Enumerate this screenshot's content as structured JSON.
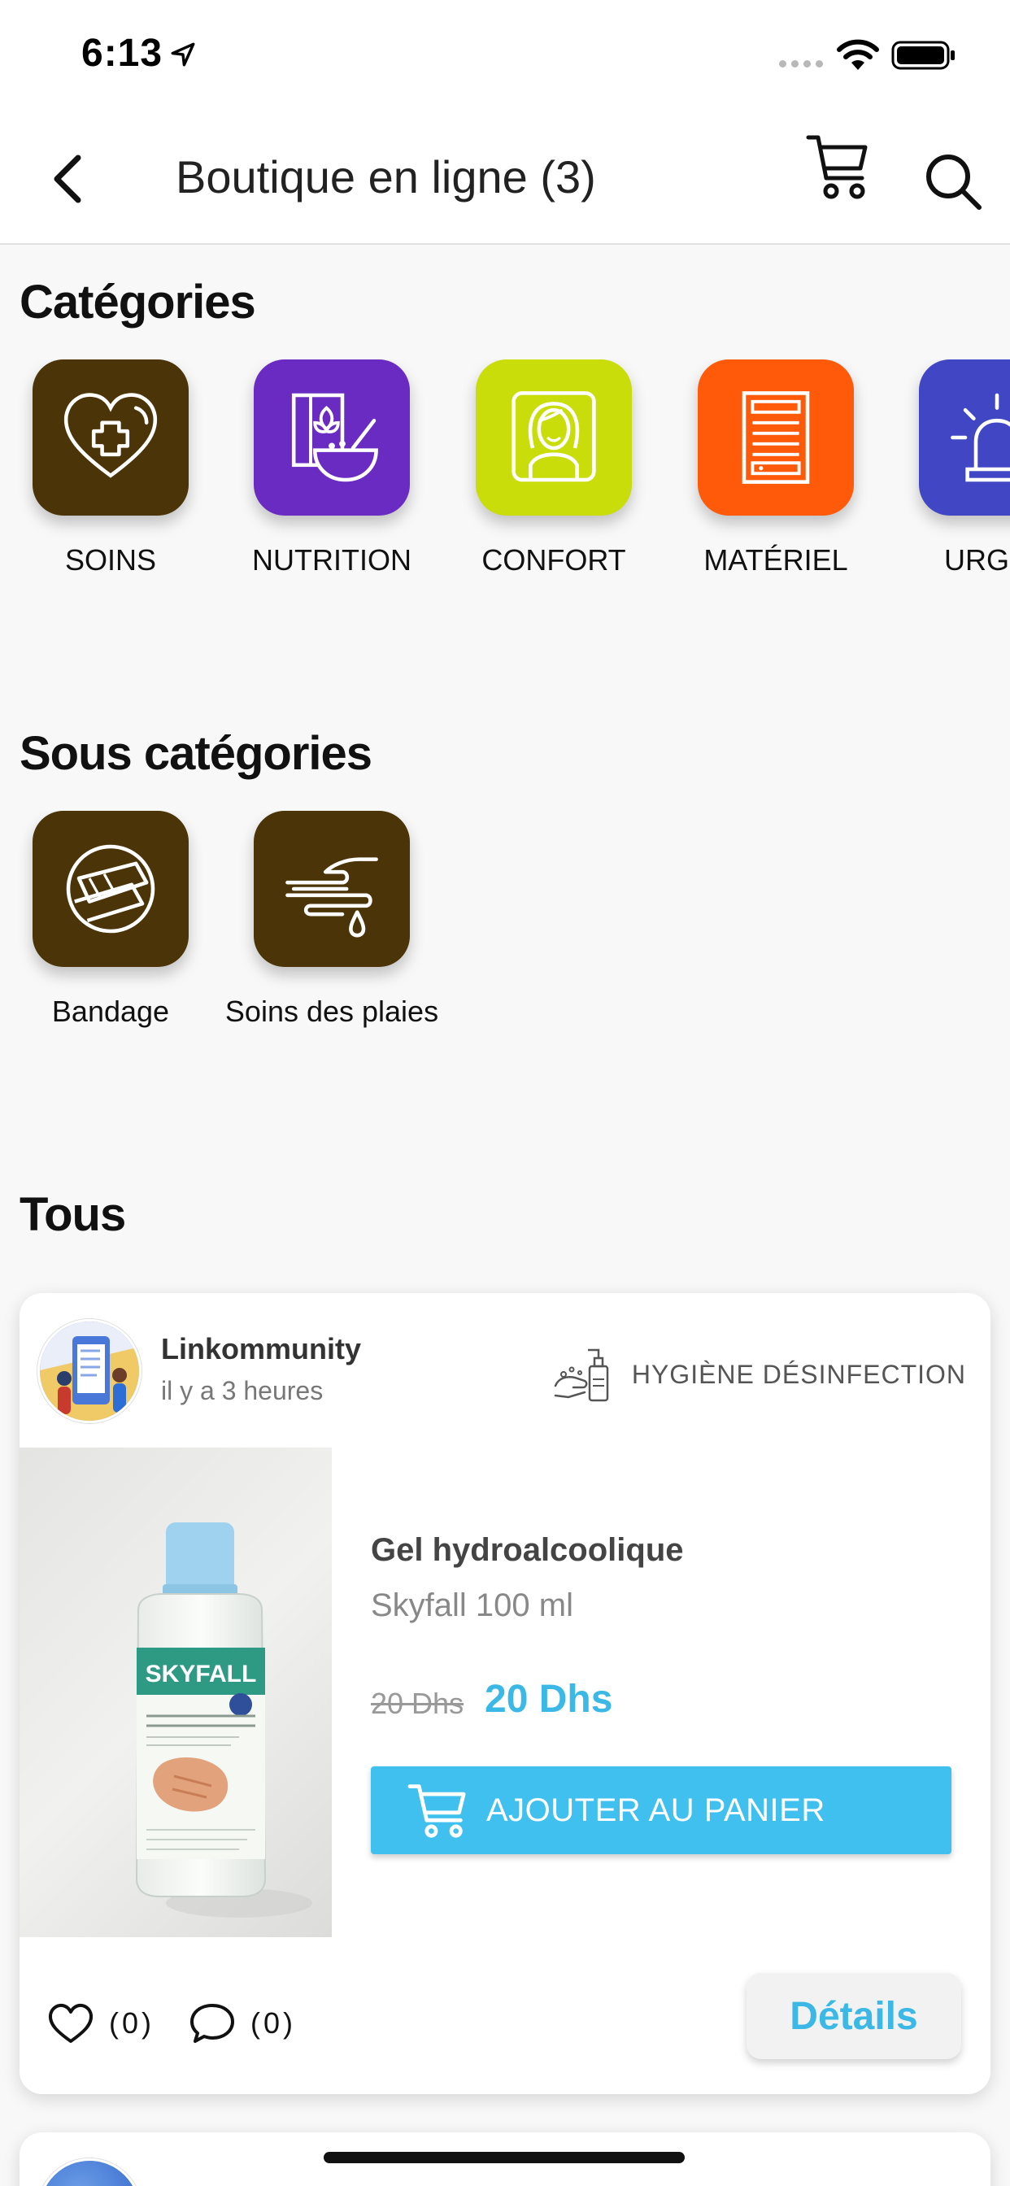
{
  "status_bar": {
    "time": "6:13"
  },
  "nav": {
    "title": "Boutique en ligne (3)"
  },
  "sections": {
    "categories": "Catégories",
    "subcategories": "Sous catégories",
    "all": "Tous"
  },
  "categories": [
    {
      "label": "SOINS",
      "color": "#4a3408",
      "icon": "heart-plus-icon"
    },
    {
      "label": "NUTRITION",
      "color": "#6a2bc2",
      "icon": "cereal-bowl-icon"
    },
    {
      "label": "CONFORT",
      "color": "#c8dd0a",
      "icon": "woman-portrait-icon"
    },
    {
      "label": "MATÉRIEL",
      "color": "#ff5a0a",
      "icon": "cabinet-icon"
    },
    {
      "label": "URGEN",
      "color": "#4147c4",
      "icon": "siren-icon"
    }
  ],
  "subcategories": [
    {
      "label": "Bandage",
      "color": "#4a3408",
      "icon": "bandage-icon"
    },
    {
      "label": "Soins des plaies",
      "color": "#4a3408",
      "icon": "wound-care-icon"
    }
  ],
  "product": {
    "author": "Linkommunity",
    "time_ago": "il y a 3 heures",
    "category": "HYGIÈNE DÉSINFECTION",
    "name": "Gel hydroalcoolique",
    "subtitle": "Skyfall 100 ml",
    "old_price": "20 Dhs",
    "new_price": "20 Dhs",
    "add_to_cart": "AJOUTER AU PANIER",
    "likes": "(0)",
    "comments": "(0)",
    "details": "Détails",
    "image_brand": "SKYFALL"
  },
  "colors": {
    "accent": "#3fc0ee",
    "price": "#3bb8e6"
  }
}
